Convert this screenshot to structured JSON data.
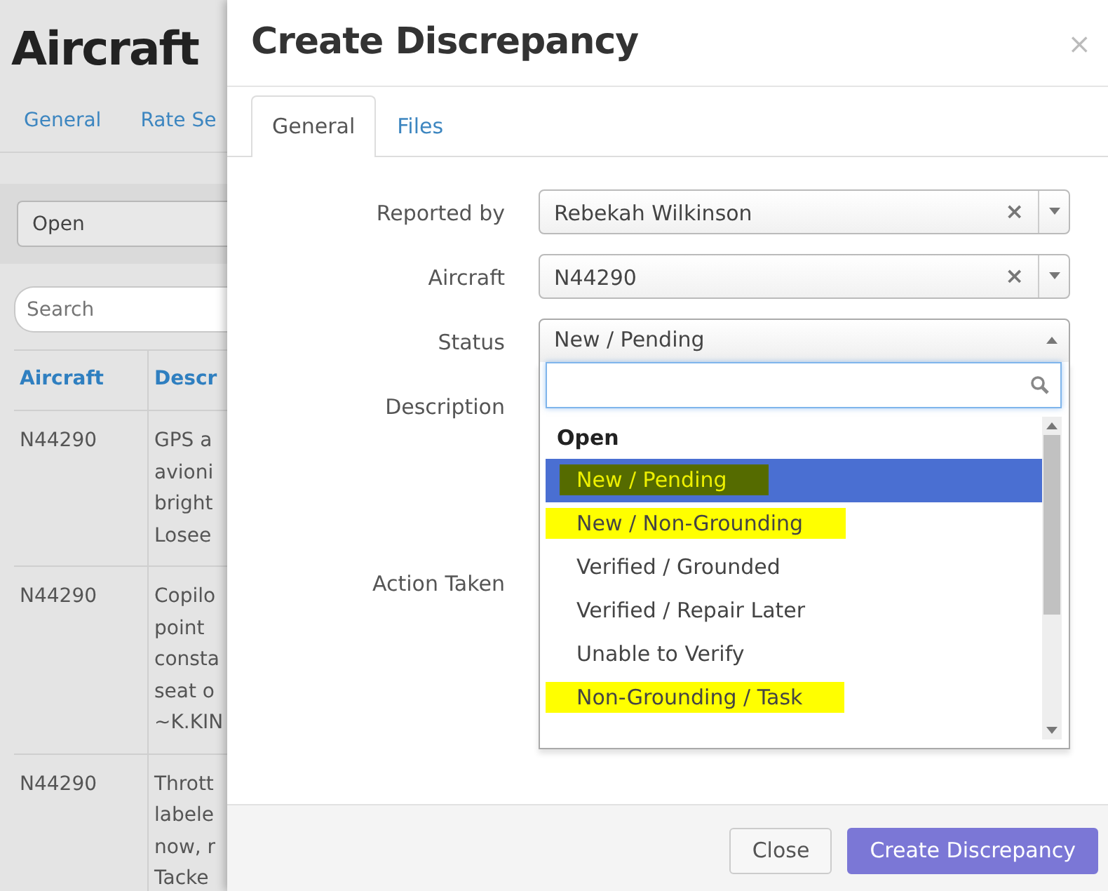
{
  "background_page": {
    "title": "Aircraft",
    "tabs": [
      {
        "label": "General"
      },
      {
        "label": "Rate Se"
      }
    ],
    "filter": {
      "value": "Open"
    },
    "search": {
      "placeholder": "Search"
    },
    "table": {
      "columns": [
        "Aircraft",
        "Descr"
      ],
      "rows": [
        {
          "aircraft": "N44290",
          "description": [
            "GPS a",
            "avioni",
            "bright",
            "Losee"
          ]
        },
        {
          "aircraft": "N44290",
          "description": [
            "Copilo",
            "point",
            "consta",
            "seat o",
            "~K.KIN"
          ]
        },
        {
          "aircraft": "N44290",
          "description": [
            "Thrott",
            "labele",
            "now, r",
            "Tacke"
          ]
        }
      ]
    }
  },
  "modal": {
    "title": "Create Discrepancy",
    "close": "×",
    "tabs": [
      {
        "label": "General",
        "selected": true
      },
      {
        "label": "Files",
        "selected": false
      }
    ],
    "fields": [
      {
        "label": "Reported by",
        "kind": "select",
        "value": "Rebekah Wilkinson",
        "clear": "×"
      },
      {
        "label": "Aircraft",
        "kind": "select",
        "value": "N44290",
        "clear": "×"
      },
      {
        "label": "Status",
        "kind": "open-select",
        "value": "New / Pending"
      },
      {
        "label": "Description",
        "kind": "textarea"
      },
      {
        "label": "Action Taken",
        "kind": "textarea"
      }
    ],
    "dropdown": {
      "groups": [
        {
          "label": "Open",
          "options": [
            {
              "label": "New / Pending",
              "selected": true,
              "highlighted": true
            },
            {
              "label": "New / Non-Grounding",
              "selected": false,
              "highlighted": true
            },
            {
              "label": "Verified / Grounded",
              "selected": false,
              "highlighted": false
            },
            {
              "label": "Verified / Repair Later",
              "selected": false,
              "highlighted": false
            },
            {
              "label": "Unable to Verify",
              "selected": false,
              "highlighted": false
            },
            {
              "label": "Non-Grounding / Task",
              "selected": false,
              "highlighted": true
            }
          ]
        }
      ]
    },
    "buttons": [
      {
        "label": "Close",
        "kind": "secondary"
      },
      {
        "label": "Create Discrepancy",
        "kind": "primary"
      }
    ]
  }
}
